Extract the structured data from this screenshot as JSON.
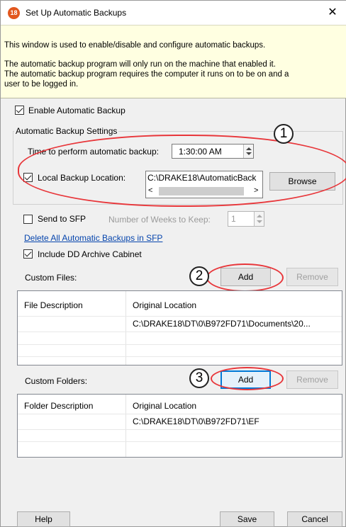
{
  "window": {
    "app_icon_text": "18",
    "title": "Set Up Automatic Backups",
    "close_glyph": "✕"
  },
  "info": {
    "line1": "This window is used to enable/disable and configure automatic backups.",
    "line2": "The automatic backup program will only run on the machine that enabled it.",
    "line3": "The automatic backup program requires the computer it runs on to be on and a",
    "line4": "user to be logged in."
  },
  "enable_backup": {
    "label": "Enable Automatic Backup",
    "checked": true
  },
  "settings_group": {
    "title": "Automatic Backup Settings",
    "time_label": "Time to perform automatic backup:",
    "time_value": "1:30:00 AM",
    "local_location": {
      "label": "Local Backup Location:",
      "checked": true,
      "path": "C:\\DRAKE18\\AutomaticBack",
      "scroll_left": "<",
      "scroll_right": ">",
      "browse_label": "Browse"
    }
  },
  "send_to_sfp": {
    "label": "Send to SFP",
    "checked": false,
    "weeks_label": "Number of Weeks to Keep:",
    "weeks_value": "1"
  },
  "delete_link": "Delete All Automatic Backups in SFP",
  "include_dd": {
    "label": "Include DD Archive Cabinet",
    "checked": true
  },
  "custom_files": {
    "label": "Custom Files:",
    "add_label": "Add",
    "remove_label": "Remove",
    "columns": [
      "File Description",
      "Original Location"
    ],
    "rows": [
      {
        "description": "",
        "location": "C:\\DRAKE18\\DT\\0\\B972FD71\\Documents\\20..."
      }
    ]
  },
  "custom_folders": {
    "label": "Custom Folders:",
    "add_label": "Add",
    "remove_label": "Remove",
    "columns": [
      "Folder Description",
      "Original Location"
    ],
    "rows": [
      {
        "description": "",
        "location": "C:\\DRAKE18\\DT\\0\\B972FD71\\EF"
      }
    ]
  },
  "annotations": {
    "one": "1",
    "two": "2",
    "three": "3",
    "color": "#e8363a"
  },
  "footer": {
    "help_label": "Help",
    "save_label": "Save",
    "cancel_label": "Cancel"
  }
}
